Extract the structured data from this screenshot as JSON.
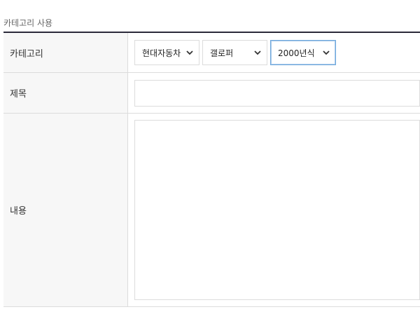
{
  "section": {
    "title": "카테고리 사용"
  },
  "form": {
    "category": {
      "label": "카테고리",
      "selects": [
        {
          "value": "현대자동차"
        },
        {
          "value": "갤로퍼"
        },
        {
          "value": "2000년식"
        }
      ]
    },
    "title": {
      "label": "제목",
      "value": ""
    },
    "content": {
      "label": "내용",
      "value": ""
    }
  },
  "colors": {
    "header_border": "#2b2a3a",
    "label_bg": "#f7f7f7",
    "border": "#dcdcdc",
    "focus_border": "#6fa8dc"
  },
  "icons": {
    "select_arrow": "chevron-down-icon"
  }
}
